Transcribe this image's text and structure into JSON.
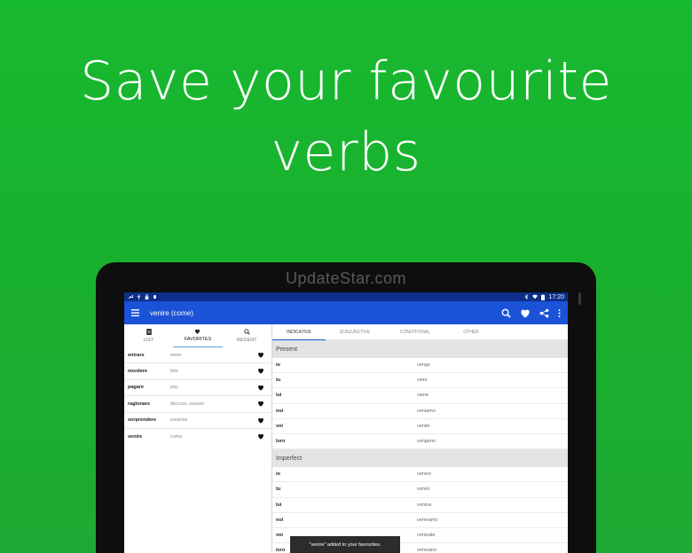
{
  "headline": "Save your favourite verbs",
  "watermark": "UpdateStar.com",
  "statusbar": {
    "time": "17:20"
  },
  "appbar": {
    "title": "venire (come)"
  },
  "left_tabs": [
    {
      "label": "LIST",
      "icon": "list-icon"
    },
    {
      "label": "FAVORITES",
      "icon": "heart-icon"
    },
    {
      "label": "RECENT",
      "icon": "search-icon"
    }
  ],
  "favorites": [
    {
      "verb": "entrare",
      "translation": "enter"
    },
    {
      "verb": "mordere",
      "translation": "bite"
    },
    {
      "verb": "pagare",
      "translation": "pay"
    },
    {
      "verb": "ragionare",
      "translation": "discuss, reason"
    },
    {
      "verb": "sorprendere",
      "translation": "surprise"
    },
    {
      "verb": "venire",
      "translation": "come"
    }
  ],
  "mood_tabs": [
    "INDICATIVE",
    "SUBJUNCTIVE",
    "CONDITIONAL",
    "OTHER"
  ],
  "sections": [
    {
      "name": "Present",
      "rows": [
        {
          "pronoun": "io",
          "form": "vengo"
        },
        {
          "pronoun": "tu",
          "form": "vieni"
        },
        {
          "pronoun": "lui",
          "form": "viene"
        },
        {
          "pronoun": "noi",
          "form": "veniamo"
        },
        {
          "pronoun": "voi",
          "form": "venite"
        },
        {
          "pronoun": "loro",
          "form": "vengono"
        }
      ]
    },
    {
      "name": "Imperfect",
      "rows": [
        {
          "pronoun": "io",
          "form": "venivo"
        },
        {
          "pronoun": "tu",
          "form": "venivi"
        },
        {
          "pronoun": "lui",
          "form": "veniva"
        },
        {
          "pronoun": "noi",
          "form": "venivamo"
        },
        {
          "pronoun": "voi",
          "form": "venivate"
        },
        {
          "pronoun": "loro",
          "form": "venivano"
        }
      ]
    }
  ],
  "toast": "\"venire\" added to your favourites."
}
